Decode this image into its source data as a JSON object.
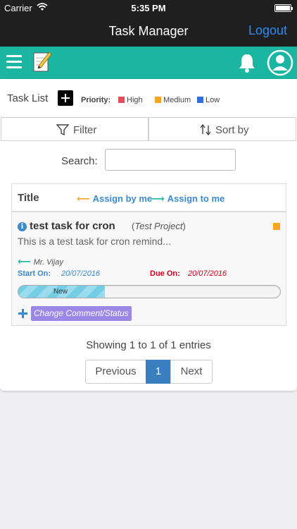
{
  "statusbar": {
    "carrier": "Carrier",
    "time": "5:35 PM"
  },
  "navbar": {
    "title": "Task Manager",
    "logout": "Logout"
  },
  "toolbar": {
    "task_list_label": "Task List",
    "priority_label": "Priority:",
    "priorities": [
      {
        "label": "High",
        "color": "#e24f5a"
      },
      {
        "label": "Medium",
        "color": "#f5a623"
      },
      {
        "label": "Low",
        "color": "#2f6de0"
      }
    ]
  },
  "filter": {
    "filter_label": "Filter",
    "sort_label": "Sort by"
  },
  "search": {
    "label": "Search:",
    "value": "",
    "placeholder": ""
  },
  "table": {
    "title_header": "Title",
    "assign_by_header": "Assign by me",
    "assign_to_header": "Assign to me",
    "assign_by_color": "#f5a623",
    "assign_to_color": "#1ab6a1",
    "rows": [
      {
        "title": "test task for cron",
        "project": "Test Project",
        "description": "This is a test task for cron remind...",
        "assigner": "Mr. Vijay",
        "start_label": "Start On:",
        "start_date": "20/07/2016",
        "due_label": "Due On:",
        "due_date": "20/07/2016",
        "priority_color": "#f5a623",
        "status": "New",
        "progress_fraction": 0.33,
        "action_label": "Change Comment/Status"
      }
    ]
  },
  "footer": {
    "showing": "Showing 1 to 1 of 1 entries"
  },
  "pagination": {
    "previous": "Previous",
    "current": "1",
    "next": "Next"
  }
}
